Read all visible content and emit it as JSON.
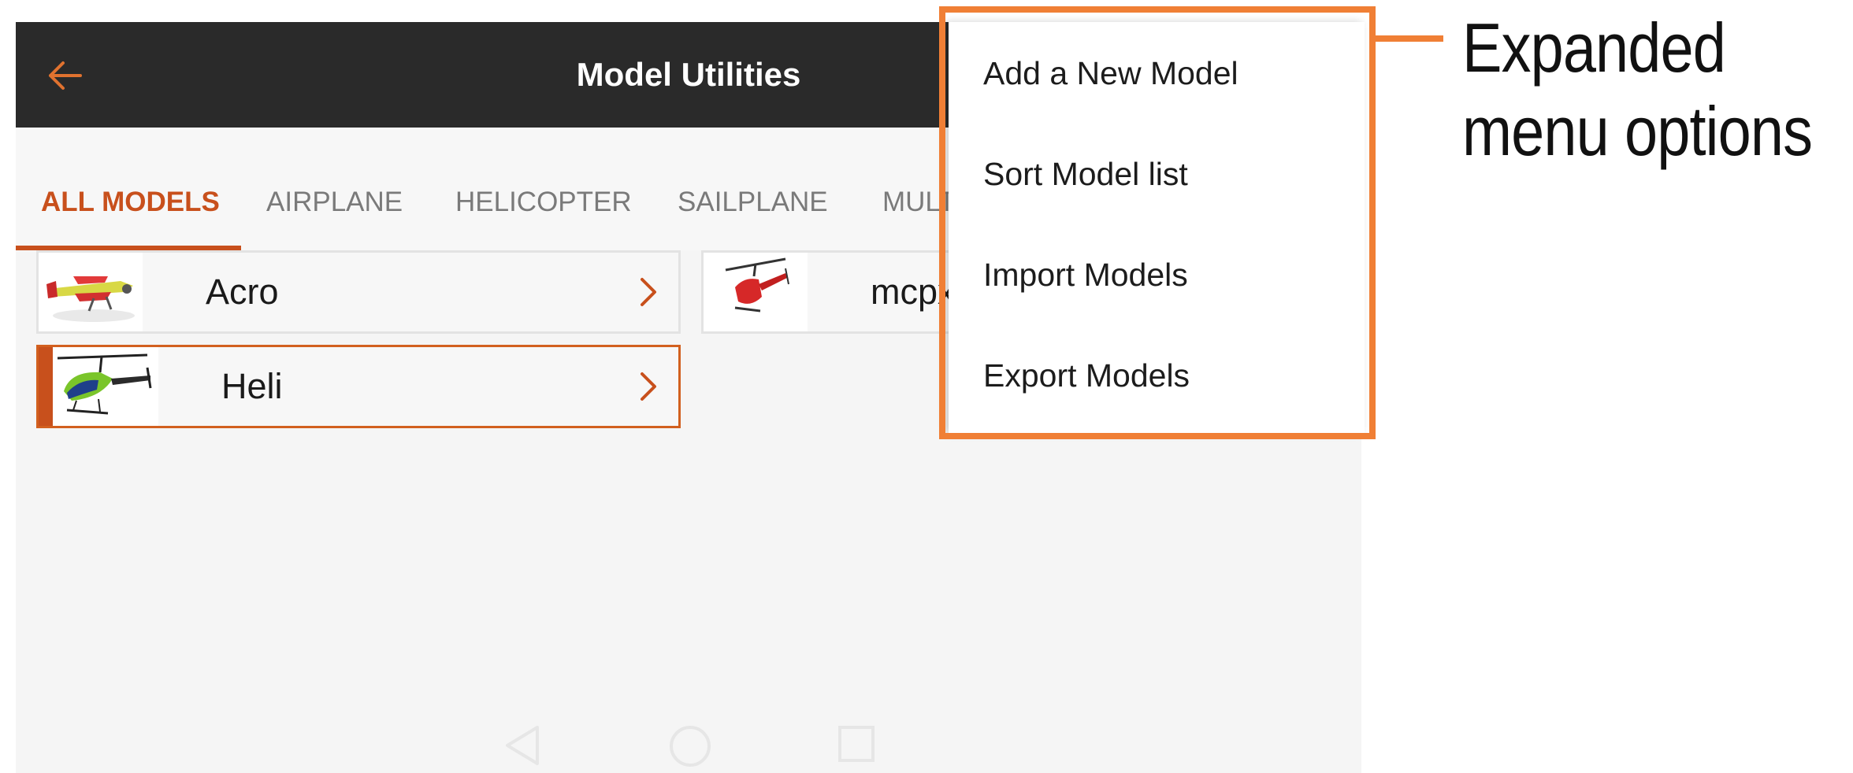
{
  "appbar": {
    "back_icon": "arrow-left-icon",
    "title": "Model Utilities"
  },
  "tabs": [
    {
      "label": "ALL MODELS",
      "active": true
    },
    {
      "label": "AIRPLANE",
      "active": false
    },
    {
      "label": "HELICOPTER",
      "active": false
    },
    {
      "label": "SAILPLANE",
      "active": false
    },
    {
      "label": "MULTI",
      "active": false
    }
  ],
  "models": [
    {
      "name": "Acro",
      "thumbnail": "airplane-icon",
      "selected": false
    },
    {
      "name": "mcpx",
      "thumbnail": "helicopter-icon",
      "selected": false
    },
    {
      "name": "Heli",
      "thumbnail": "helicopter-icon",
      "selected": true
    }
  ],
  "menu": {
    "items": [
      "Add a New Model",
      "Sort Model list",
      "Import Models",
      "Export Models"
    ]
  },
  "navbar": {
    "icons": [
      "nav-back-icon",
      "nav-home-icon",
      "nav-recents-icon"
    ]
  },
  "annotation": {
    "line1": "Expanded",
    "line2": "menu options"
  },
  "colors": {
    "accent": "#c8501c",
    "callout": "#f07f35",
    "appbar": "#2a2a2a"
  }
}
